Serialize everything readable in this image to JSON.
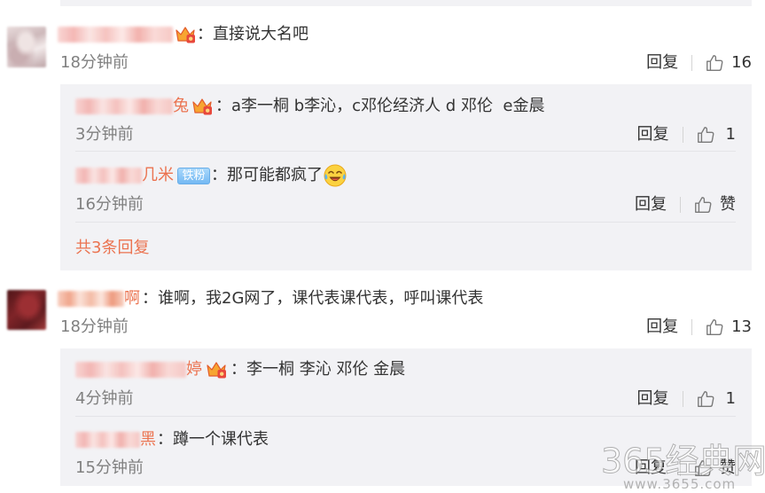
{
  "comments": [
    {
      "badge_icon": "vip-crown-icon",
      "text": "：直接说大名吧",
      "time": "18分钟前",
      "reply_label": "回复",
      "likes": "16",
      "replies": [
        {
          "username_visible": "兔",
          "badge_icon": "vip-crown-icon",
          "text": "：a李一桐 b李沁，c邓伦经济人 d 邓伦  e金晨",
          "time": "3分钟前",
          "reply_label": "回复",
          "likes": "1"
        },
        {
          "username_visible": "几米",
          "badge_label": "铁粉",
          "text": "：那可能都疯了",
          "emoji_icon": "laugh-cry-emoji-icon",
          "time": "16分钟前",
          "reply_label": "回复",
          "likes": "赞"
        }
      ],
      "more_replies": "共3条回复"
    },
    {
      "username_visible": "啊",
      "text": "：谁啊，我2G网了，课代表课代表，呼叫课代表",
      "time": "18分钟前",
      "reply_label": "回复",
      "likes": "13",
      "replies": [
        {
          "username_visible": "婷",
          "badge_icon": "vip-crown-icon",
          "text": "：李一桐 李沁 邓伦 金晨",
          "time": "4分钟前",
          "reply_label": "回复",
          "likes": "1"
        },
        {
          "username_visible": "黑",
          "text": "：蹲一个课代表",
          "time": "15分钟前",
          "reply_label": "回复",
          "likes": "赞"
        }
      ]
    }
  ],
  "icons": {
    "like": "thumbs-up-icon",
    "avatar": "avatar"
  },
  "watermark": {
    "title": "365经典网",
    "url": "www.3655.com"
  },
  "colors": {
    "username": "#eb7350",
    "text": "#333333",
    "time": "#808080",
    "reply_box_bg": "#f2f2f5",
    "more_replies": "#eb7350",
    "fan_badge": "#74b9f3"
  }
}
